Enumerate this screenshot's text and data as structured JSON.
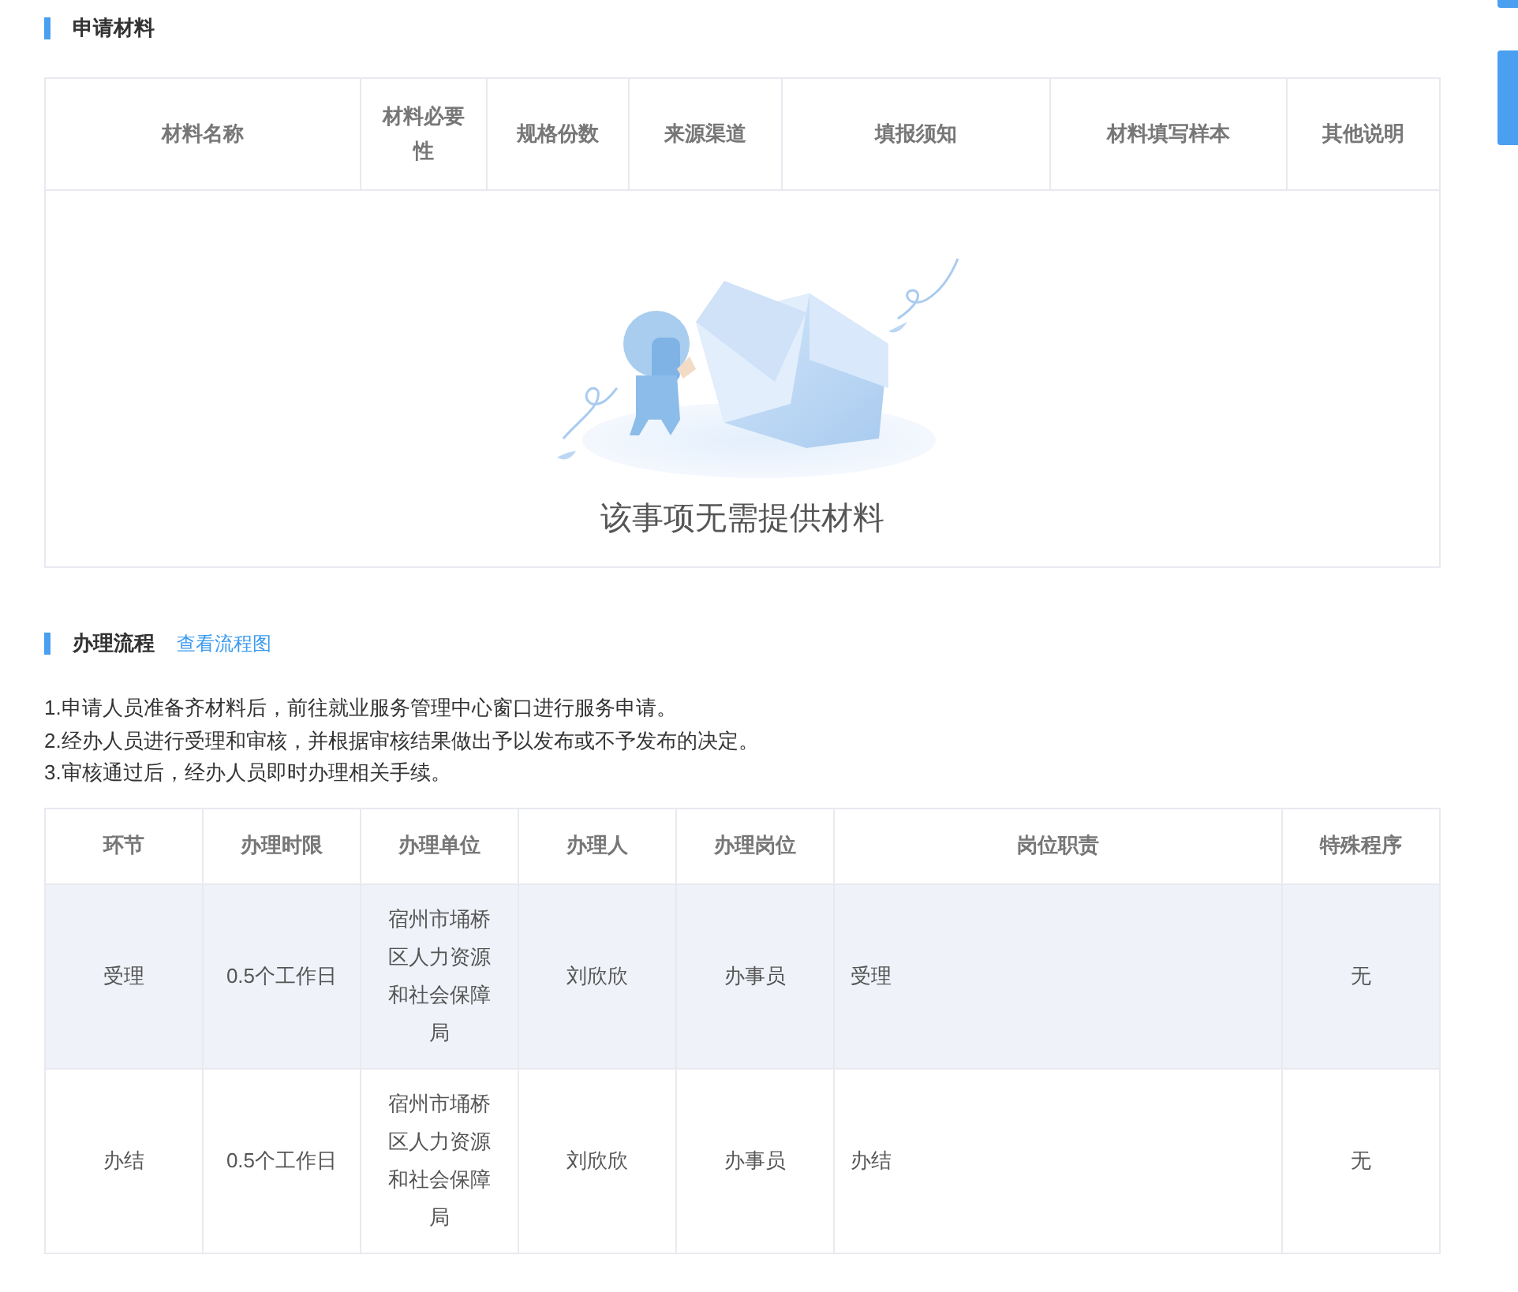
{
  "materials": {
    "title": "申请材料",
    "columns": [
      "材料名称",
      "材料必要性",
      "规格份数",
      "来源渠道",
      "填报须知",
      "材料填写样本",
      "其他说明"
    ],
    "empty_message": "该事项无需提供材料"
  },
  "process": {
    "title": "办理流程",
    "link": "查看流程图",
    "steps": [
      "1.申请人员准备齐材料后，前往就业服务管理中心窗口进行服务申请。",
      "2.经办人员进行受理和审核，并根据审核结果做出予以发布或不予发布的决定。",
      "3.审核通过后，经办人员即时办理相关手续。"
    ],
    "columns": [
      "环节",
      "办理时限",
      "办理单位",
      "办理人",
      "办理岗位",
      "岗位职责",
      "特殊程序"
    ],
    "rows": [
      {
        "highlighted": true,
        "cells": [
          "受理",
          "0.5个工作日",
          "宿州市埇桥区人力资源和社会保障局",
          "刘欣欣",
          "办事员",
          "受理",
          "无"
        ]
      },
      {
        "highlighted": false,
        "cells": [
          "办结",
          "0.5个工作日",
          "宿州市埇桥区人力资源和社会保障局",
          "刘欣欣",
          "办事员",
          "办结",
          "无"
        ]
      }
    ]
  }
}
